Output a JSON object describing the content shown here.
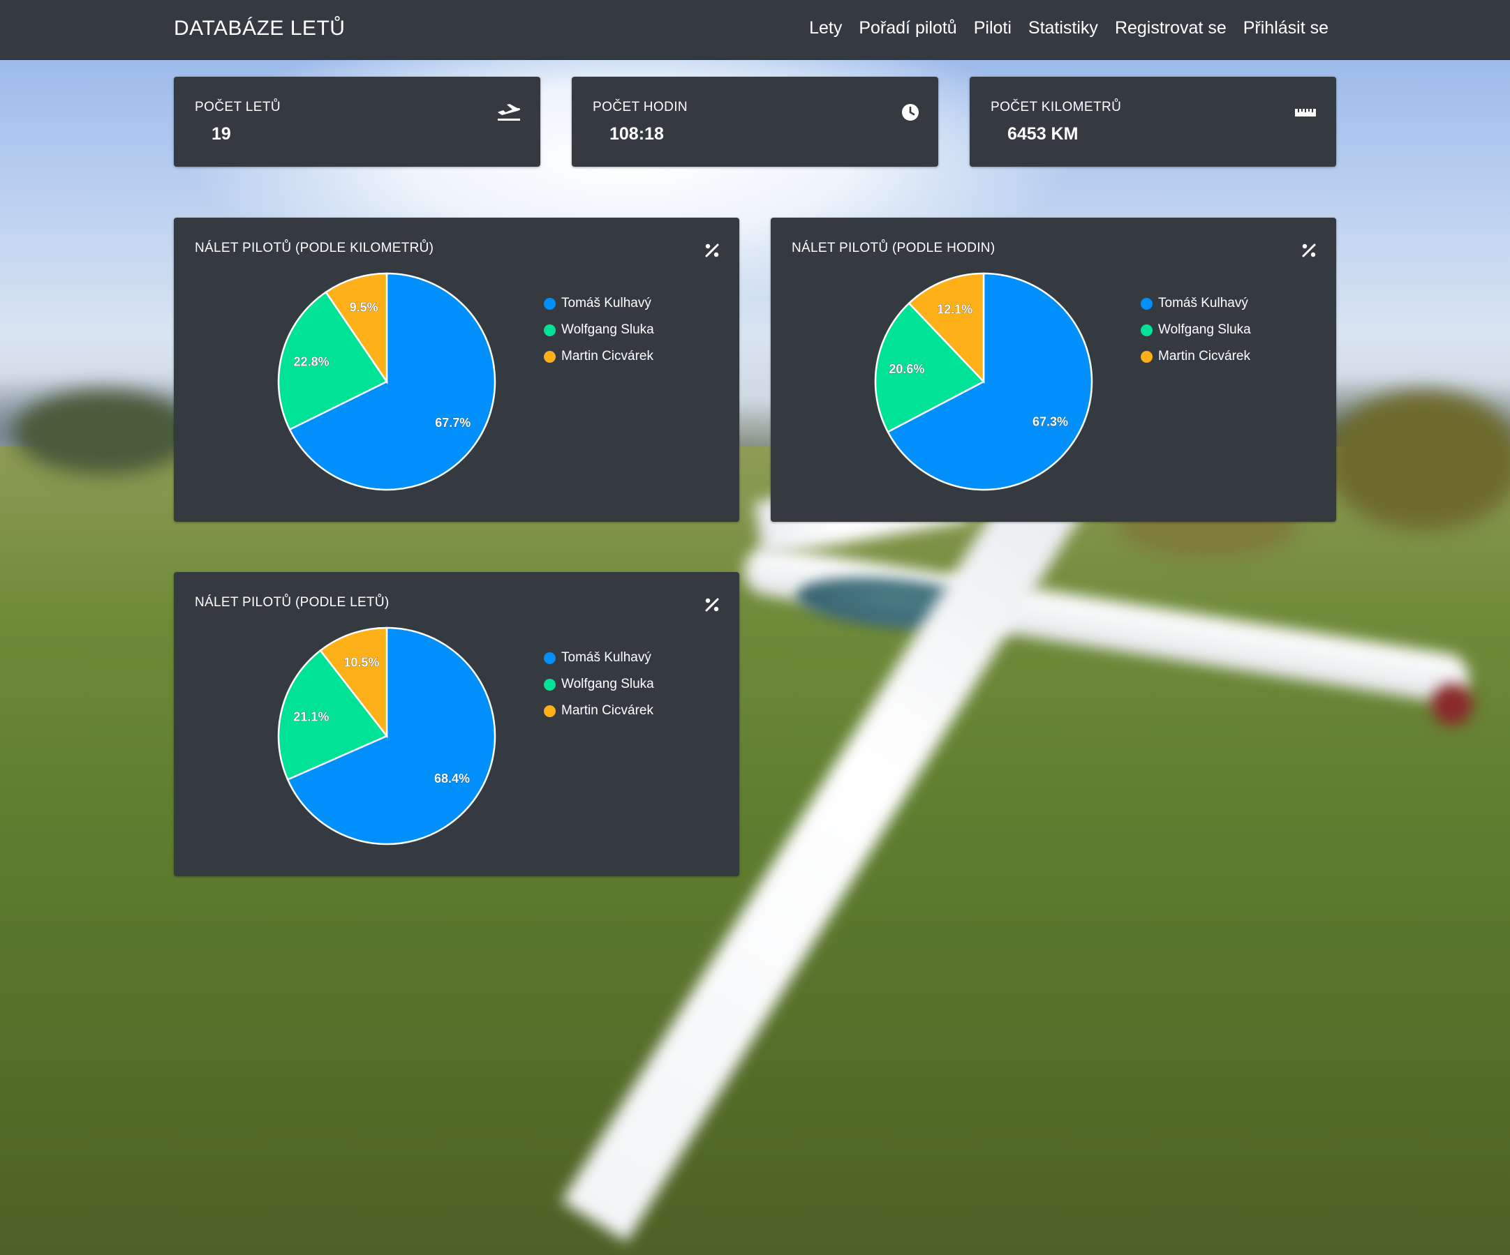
{
  "navbar": {
    "brand": "DATABÁZE LETŮ",
    "links": [
      "Lety",
      "Pořadí pilotů",
      "Piloti",
      "Statistiky",
      "Registrovat se",
      "Přihlásit se"
    ]
  },
  "stats": [
    {
      "title": "POČET LETŮ",
      "value": "19",
      "icon": "plane-departure-icon"
    },
    {
      "title": "POČET HODIN",
      "value": "108:18",
      "icon": "clock-icon"
    },
    {
      "title": "POČET KILOMETRŮ",
      "value": "6453 KM",
      "icon": "ruler-icon"
    }
  ],
  "colors": {
    "card": "#343a40",
    "series": [
      "#008ffb",
      "#00e396",
      "#feb019"
    ]
  },
  "charts": [
    {
      "title": "NÁLET PILOTŮ (PODLE KILOMETRŮ)"
    },
    {
      "title": "NÁLET PILOTŮ (PODLE HODIN)"
    },
    {
      "title": "NÁLET PILOTŮ (PODLE LETŮ)"
    }
  ],
  "chart_data": [
    {
      "type": "pie",
      "title": "NÁLET PILOTŮ (PODLE KILOMETRŮ)",
      "categories": [
        "Tomáš Kulhavý",
        "Wolfgang Sluka",
        "Martin Cicvárek"
      ],
      "values": [
        67.7,
        22.8,
        9.5
      ],
      "labels": [
        "67.7%",
        "22.8%",
        "9.5%"
      ],
      "legend": "right"
    },
    {
      "type": "pie",
      "title": "NÁLET PILOTŮ (PODLE HODIN)",
      "categories": [
        "Tomáš Kulhavý",
        "Wolfgang Sluka",
        "Martin Cicvárek"
      ],
      "values": [
        67.3,
        20.6,
        12.1
      ],
      "labels": [
        "67.3%",
        "20.6%",
        "12.1%"
      ],
      "legend": "right"
    },
    {
      "type": "pie",
      "title": "NÁLET PILOTŮ (PODLE LETŮ)",
      "categories": [
        "Tomáš Kulhavý",
        "Wolfgang Sluka",
        "Martin Cicvárek"
      ],
      "values": [
        68.4,
        21.1,
        10.5
      ],
      "labels": [
        "68.4%",
        "21.1%",
        "10.5%"
      ],
      "legend": "right"
    }
  ]
}
